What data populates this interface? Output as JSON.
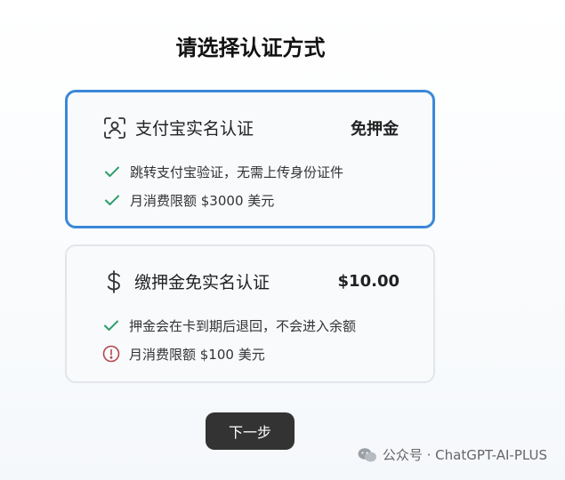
{
  "page": {
    "title": "请选择认证方式"
  },
  "options": [
    {
      "name": "支付宝实名认证",
      "price": "免押金",
      "icon": "face-scan-icon",
      "features": [
        {
          "icon": "check-icon",
          "text": "跳转支付宝验证，无需上传身份证件"
        },
        {
          "icon": "check-icon",
          "text": "月消费限额 $3000 美元"
        }
      ]
    },
    {
      "name": "缴押金免实名认证",
      "price": "$10.00",
      "icon": "dollar-icon",
      "features": [
        {
          "icon": "check-icon",
          "text": "押金会在卡到期后退回，不会进入余额"
        },
        {
          "icon": "info-icon",
          "text": "月消费限额 $100 美元"
        }
      ]
    }
  ],
  "actions": {
    "next_label": "下一步"
  },
  "watermark": {
    "text": "公众号 · ChatGPT-AI-PLUS",
    "icon": "wechat-icon"
  },
  "colors": {
    "selected_border": "#3b88d9",
    "check": "#2e9e6b",
    "info": "#b5474f",
    "button_bg": "#333333"
  }
}
